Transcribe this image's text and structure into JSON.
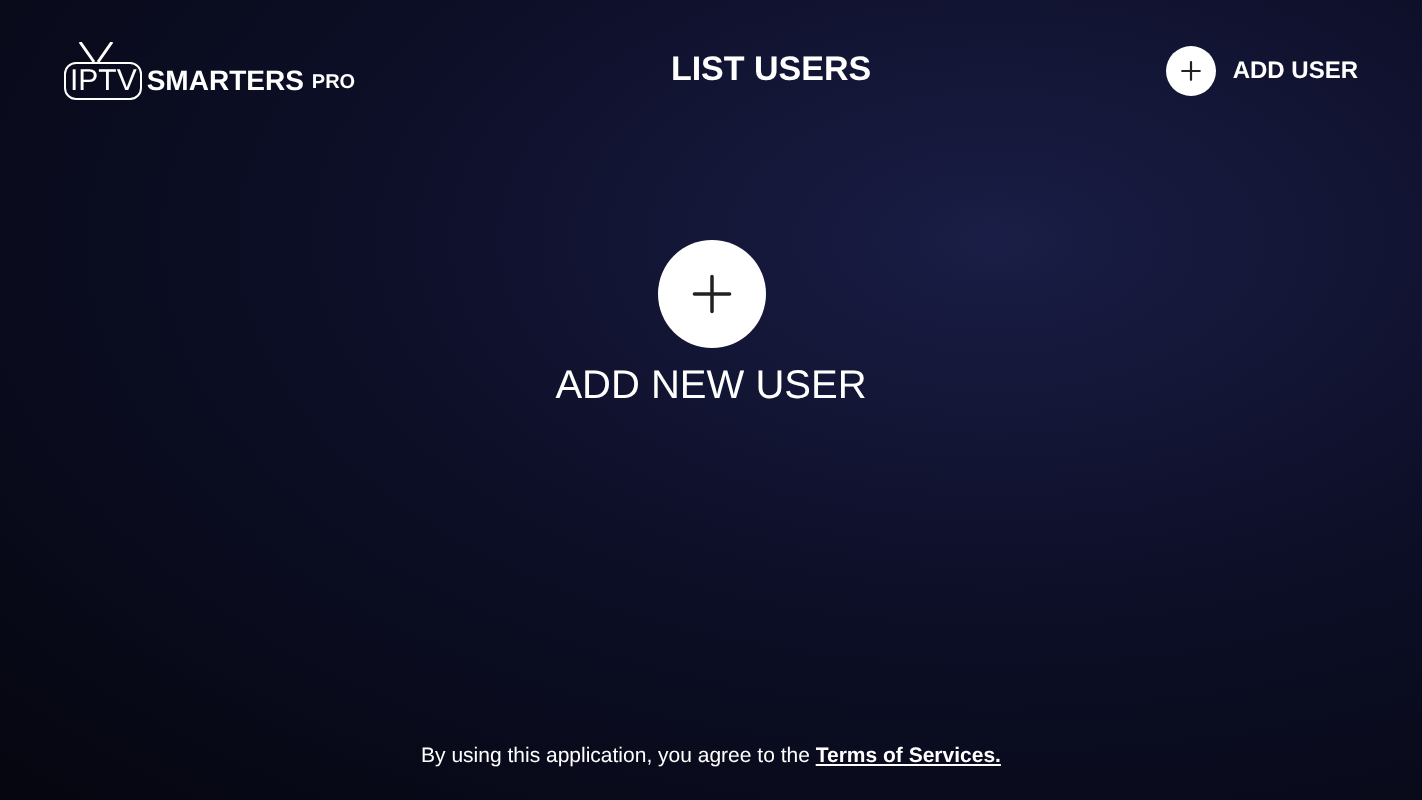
{
  "logo": {
    "tv": "IPTV",
    "brand": "SMARTERS",
    "suffix": "PRO"
  },
  "title": "LIST USERS",
  "add_user_button": {
    "label": "ADD USER"
  },
  "add_new_user": {
    "label": "ADD NEW USER"
  },
  "footer": {
    "text": "By using this application, you agree to the",
    "link": "Terms of Services."
  }
}
